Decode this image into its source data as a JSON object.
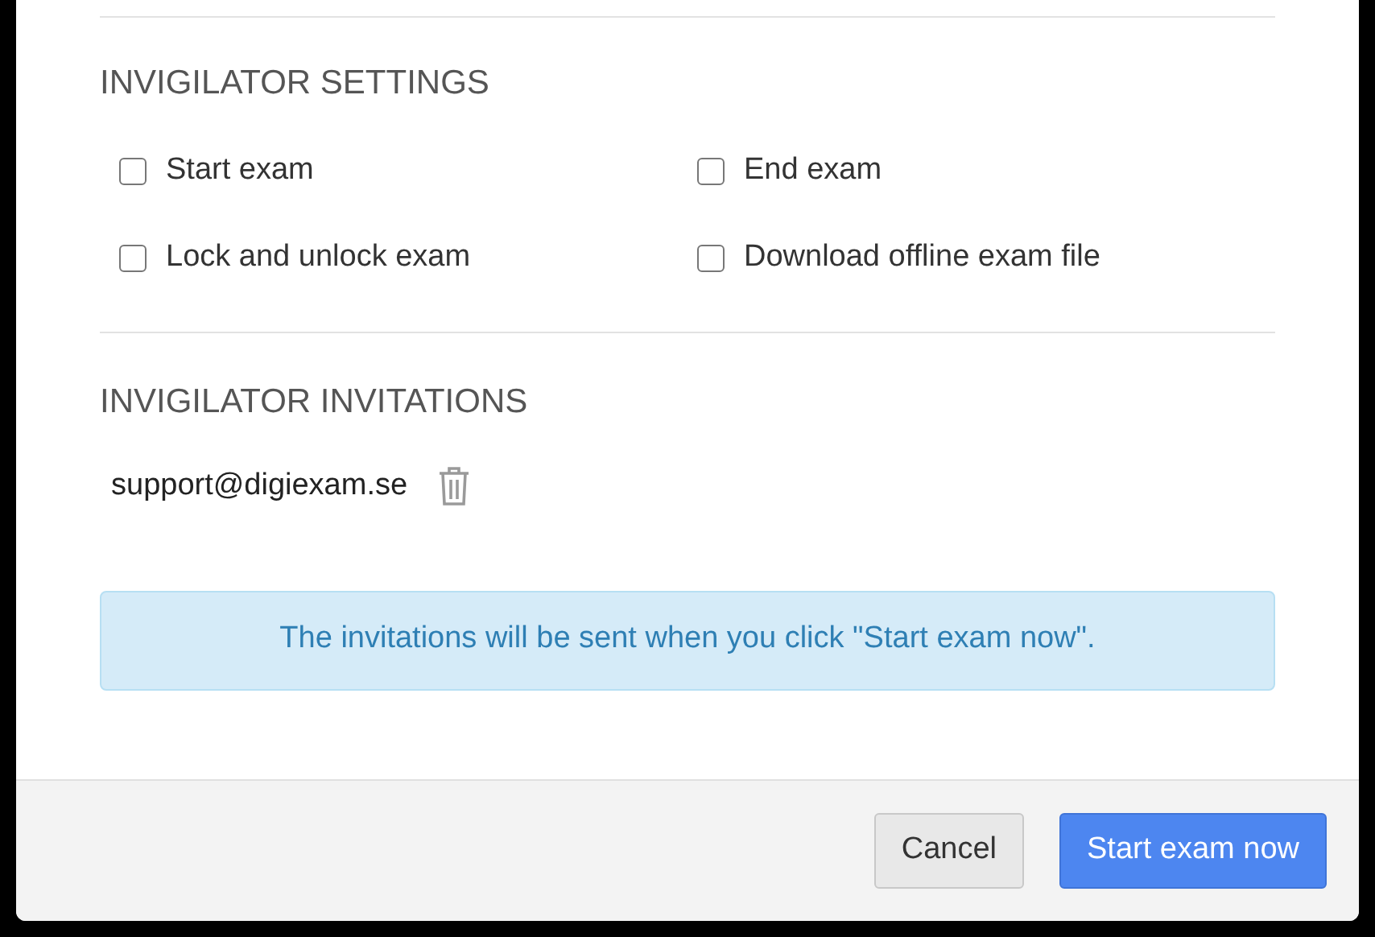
{
  "sections": [
    {
      "title": "INVIGILATOR SETTINGS",
      "options": [
        {
          "label": "Start exam",
          "checked": false
        },
        {
          "label": "End exam",
          "checked": false
        },
        {
          "label": "Lock and unlock exam",
          "checked": false
        },
        {
          "label": "Download offline exam file",
          "checked": false
        }
      ]
    },
    {
      "title": "INVIGILATOR INVITATIONS",
      "invitations": [
        {
          "email": "support@digiexam.se"
        }
      ],
      "notice": "The invitations will be sent when you click \"Start exam now\"."
    }
  ],
  "buttons": [
    {
      "label": "Cancel",
      "kind": "secondary"
    },
    {
      "label": "Start exam now",
      "kind": "primary"
    }
  ]
}
